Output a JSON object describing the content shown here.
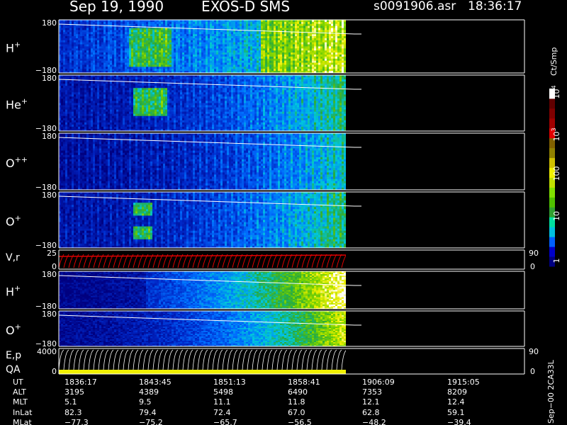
{
  "header": {
    "date": "Sep 19, 1990",
    "title": "EXOS-D SMS",
    "file": "s0091906.asr",
    "time": "18:36:17"
  },
  "colorbar": {
    "unit": "Ct/Smp",
    "ticks": [
      "1",
      "10",
      "100",
      "10",
      "10"
    ],
    "tick_exponents": [
      "",
      "",
      "",
      "3",
      "4"
    ],
    "colors": [
      "#000080",
      "#0000c8",
      "#0060ff",
      "#00c0e0",
      "#00e0a0",
      "#30a030",
      "#50c000",
      "#80e000",
      "#c0e000",
      "#f0f000",
      "#d0c000",
      "#908000",
      "#806000",
      "#e00000",
      "#a00000",
      "#800000",
      "#600000",
      "#ffffff"
    ]
  },
  "panels": [
    {
      "id": "hplus1",
      "label": "H",
      "sup": "+",
      "top_tick": "180",
      "bottom_tick": "−180",
      "style": "h1"
    },
    {
      "id": "heplus",
      "label": "He",
      "sup": "+",
      "top_tick": "180",
      "bottom_tick": "−180",
      "style": "he"
    },
    {
      "id": "oplusplus",
      "label": "O",
      "sup": "++",
      "top_tick": "180",
      "bottom_tick": "−180",
      "style": "opp"
    },
    {
      "id": "oplus1",
      "label": "O",
      "sup": "+",
      "top_tick": "180",
      "bottom_tick": "−180",
      "style": "op1"
    },
    {
      "id": "vr",
      "label": "V,r",
      "sup": "",
      "top_tick": "25",
      "bottom_tick": "0",
      "right_top": "90",
      "right_bottom": "0",
      "style": "vr"
    },
    {
      "id": "hplus2",
      "label": "H",
      "sup": "+",
      "top_tick": "180",
      "bottom_tick": "−180",
      "style": "h2"
    },
    {
      "id": "oplus2",
      "label": "O",
      "sup": "+",
      "top_tick": "180",
      "bottom_tick": "−180",
      "style": "op2"
    },
    {
      "id": "ep",
      "label": "E,p",
      "label2": "QA",
      "sup": "",
      "top_tick": "4000",
      "bottom_tick": "0",
      "right_top": "90",
      "right_bottom": "0",
      "style": "ep"
    }
  ],
  "orbit_table": {
    "rows": [
      {
        "label": "UT",
        "values": [
          "1836:17",
          "1843:45",
          "1851:13",
          "1858:41",
          "1906:09",
          "1915:05"
        ]
      },
      {
        "label": "ALT",
        "values": [
          "3195",
          "4389",
          "5498",
          "6490",
          "7353",
          "8209"
        ]
      },
      {
        "label": "MLT",
        "values": [
          "5.1",
          "9.5",
          "11.1",
          "11.8",
          "12.1",
          "12.4"
        ]
      },
      {
        "label": "InLat",
        "values": [
          "82.3",
          "79.4",
          "72.4",
          "67.0",
          "62.8",
          "59.1"
        ]
      },
      {
        "label": "MLat",
        "values": [
          "−77.3",
          "−75.2",
          "−65.7",
          "−56.5",
          "−48.2",
          "−39.4"
        ]
      }
    ]
  },
  "footer_note": "Sep−00 2CA33L",
  "chart_data": {
    "type": "heatmap",
    "title": "Sep 19, 1990   EXOS-D SMS",
    "xlabel": "UT",
    "x": [
      "1836:17",
      "1843:45",
      "1851:13",
      "1858:41",
      "1906:09",
      "1915:05"
    ],
    "series": [
      {
        "name": "H+",
        "ylim": [
          -180,
          180
        ]
      },
      {
        "name": "He+",
        "ylim": [
          -180,
          180
        ]
      },
      {
        "name": "O++",
        "ylim": [
          -180,
          180
        ]
      },
      {
        "name": "O+",
        "ylim": [
          -180,
          180
        ]
      },
      {
        "name": "V,r",
        "ylim": [
          0,
          25
        ],
        "right_ylim": [
          0,
          90
        ]
      },
      {
        "name": "H+",
        "ylim": [
          -180,
          180
        ]
      },
      {
        "name": "O+",
        "ylim": [
          -180,
          180
        ]
      },
      {
        "name": "E,p",
        "ylim": [
          0,
          4000
        ],
        "right_ylim": [
          0,
          90
        ]
      }
    ],
    "colorbar": {
      "label": "Ct/Smp",
      "scale": "log",
      "range": [
        1,
        10000
      ]
    }
  }
}
